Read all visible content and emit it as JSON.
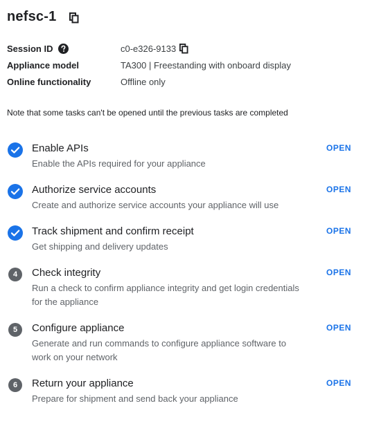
{
  "header": {
    "title": "nefsc-1"
  },
  "info": {
    "session_label": "Session ID",
    "session_value": "c0-e326-9133",
    "model_label": "Appliance model",
    "model_value": "TA300 | Freestanding with onboard display",
    "online_label": "Online functionality",
    "online_value": "Offline only"
  },
  "note": "Note that some tasks can't be opened until the previous tasks are completed",
  "tasks": [
    {
      "status": "completed",
      "step": "1",
      "title": "Enable APIs",
      "desc": "Enable the APIs required for your appliance",
      "action": "OPEN"
    },
    {
      "status": "completed",
      "step": "2",
      "title": "Authorize service accounts",
      "desc": "Create and authorize service accounts your appliance will use",
      "action": "OPEN"
    },
    {
      "status": "completed",
      "step": "3",
      "title": "Track shipment and confirm receipt",
      "desc": "Get shipping and delivery updates",
      "action": "OPEN"
    },
    {
      "status": "pending",
      "step": "4",
      "title": "Check integrity",
      "desc": "Run a check to confirm appliance integrity and get login credentials for the appliance",
      "action": "OPEN"
    },
    {
      "status": "pending",
      "step": "5",
      "title": "Configure appliance",
      "desc": "Generate and run commands to configure appliance software to work on your network",
      "action": "OPEN"
    },
    {
      "status": "pending",
      "step": "6",
      "title": "Return your appliance",
      "desc": "Prepare for shipment and send back your appliance",
      "action": "OPEN"
    }
  ],
  "colors": {
    "accent": "#1a73e8",
    "check": "#1a73e8",
    "step_badge": "#5f6368",
    "text_secondary": "#5f6368"
  },
  "icons": {
    "copy": "copy-icon",
    "help": "help-icon",
    "completed": "check-circle-icon"
  }
}
